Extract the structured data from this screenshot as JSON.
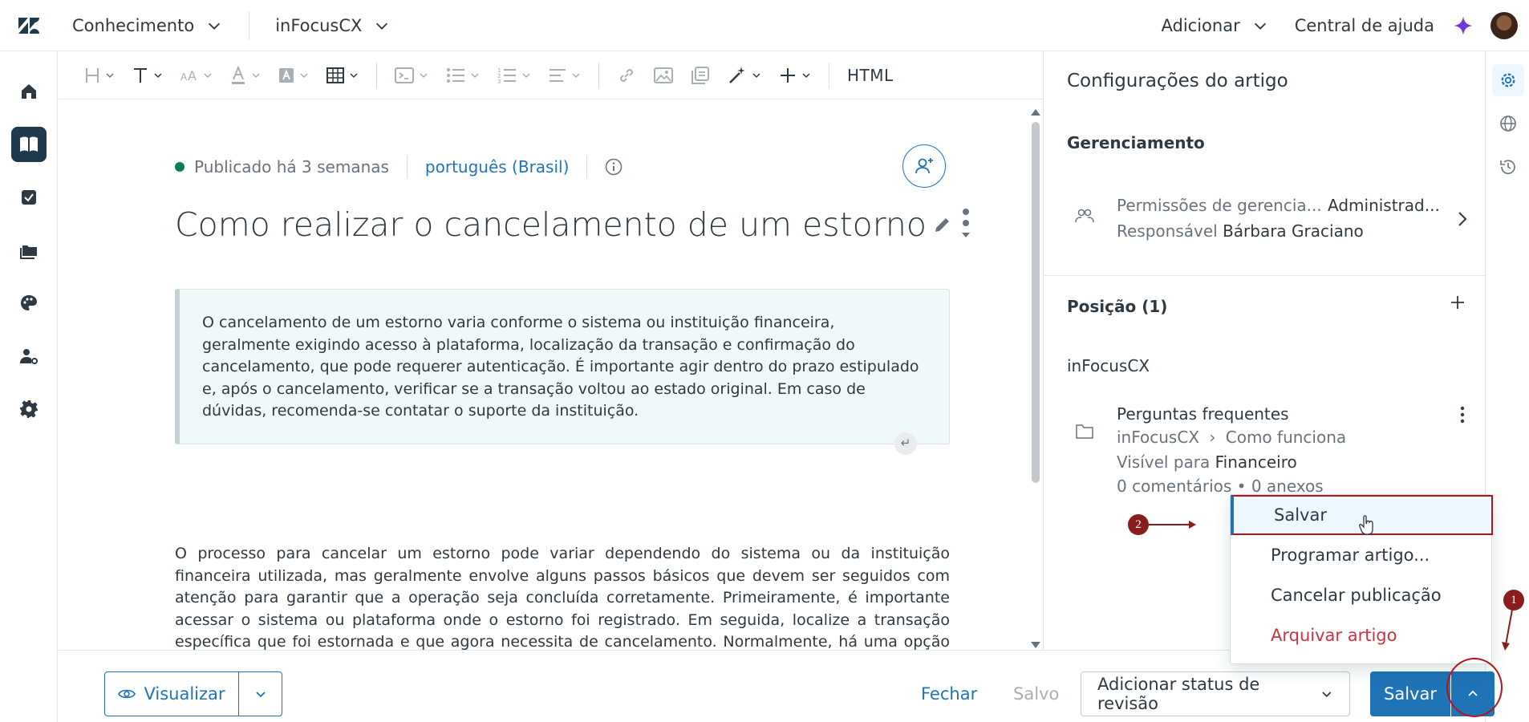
{
  "topbar": {
    "product": "Conhecimento",
    "brand": "inFocusCX",
    "add": "Adicionar",
    "help_center": "Central de ajuda"
  },
  "toolbar": {
    "html_label": "HTML"
  },
  "article": {
    "status": "Publicado há 3 semanas",
    "language": "português (Brasil)",
    "title": "Como realizar o cancelamento de um estorno",
    "callout": "O cancelamento de um estorno varia conforme o sistema ou instituição financeira, geralmente exigindo acesso à plataforma, localização da transação e confirmação do cancelamento, que pode requerer autenticação. É importante agir dentro do prazo estipulado e, após o cancelamento, verificar se a transação voltou ao estado original. Em caso de dúvidas, recomenda-se contatar o suporte da instituição.",
    "body": "O processo para cancelar um estorno pode variar dependendo do sistema ou da instituição financeira utilizada, mas geralmente envolve alguns passos básicos que devem ser seguidos com atenção para garantir que a operação seja concluída corretamente. Primeiramente, é importante acessar o sistema ou plataforma onde o estorno foi registrado. Em seguida, localize a transação específica que foi estornada e que agora necessita de cancelamento. Normalmente, há uma opção para visualizar os detalhes da operação, onde será possível encontrar a função de cancelamento do estorno."
  },
  "bottombar": {
    "preview": "Visualizar",
    "close": "Fechar",
    "saved": "Salvo",
    "review_status": "Adicionar status de revisão",
    "save": "Salvar"
  },
  "settings": {
    "title": "Configurações do artigo",
    "management_heading": "Gerenciamento",
    "permissions_label": "Permissões de gerencia...",
    "permissions_value": "Administrad...",
    "owner_label": "Responsável",
    "owner_value": "Bárbara Graciano",
    "position_heading": "Posição (1)",
    "brand": "inFocusCX",
    "section_name": "Perguntas frequentes",
    "path_brand": "inFocusCX",
    "path_category": "Como funciona",
    "visible_label": "Visível para",
    "visible_value": "Financeiro",
    "comments": "0 comentários",
    "attachments": "0 anexos"
  },
  "menu": {
    "items": [
      "Salvar",
      "Programar artigo...",
      "Cancelar publicação",
      "Arquivar artigo"
    ]
  },
  "annotations": {
    "step1": "1",
    "step2": "2"
  }
}
